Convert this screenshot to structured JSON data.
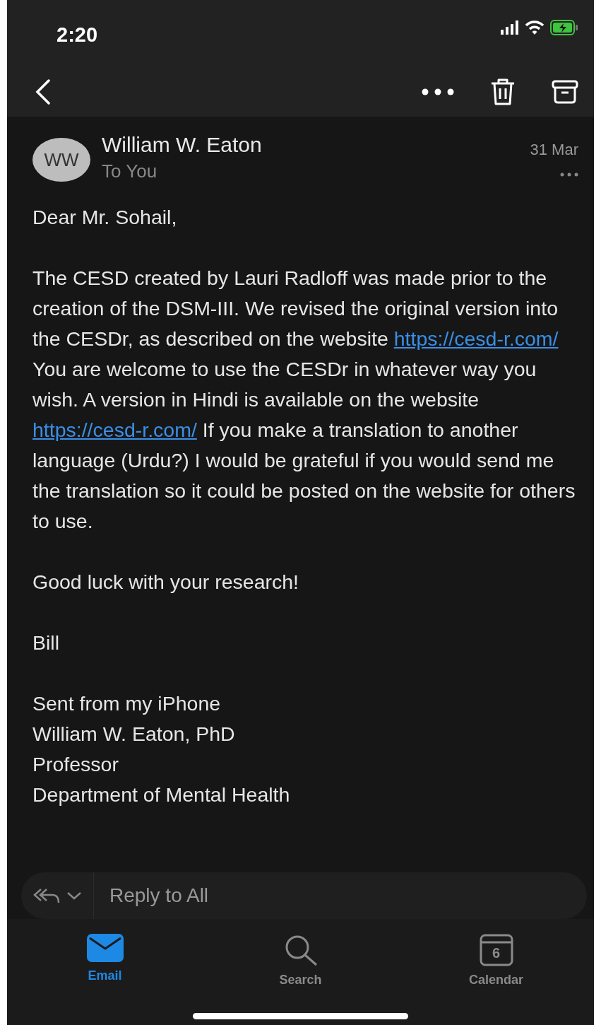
{
  "status_bar": {
    "time": "2:20"
  },
  "message": {
    "avatar_initials": "WW",
    "sender": "William W. Eaton",
    "recipient": "To You",
    "date": "31 Mar",
    "paragraphs": [
      {
        "parts": [
          {
            "kind": "text",
            "text": "Dear Mr. Sohail,"
          }
        ]
      },
      {
        "parts": [
          {
            "kind": "text",
            "text": "The CESD created by Lauri Radloff was made prior to the creation of the DSM-III.  We revised the original version into the CESDr, as described on the website "
          },
          {
            "kind": "link",
            "text": "https://cesd-r.com/"
          },
          {
            "kind": "text",
            "text": " You are welcome to use the CESDr in whatever way you wish.  A version in Hindi is available on the website "
          },
          {
            "kind": "link",
            "text": "https://cesd-r.com/"
          },
          {
            "kind": "text",
            "text": "   If you make a translation to another language (Urdu?) I would be grateful if you would send me the translation so it could be posted on the website for others to use."
          }
        ]
      },
      {
        "parts": [
          {
            "kind": "text",
            "text": "Good luck with your research!"
          }
        ]
      },
      {
        "parts": [
          {
            "kind": "text",
            "text": "Bill"
          }
        ]
      }
    ],
    "signature": [
      "Sent from my iPhone",
      "William W. Eaton, PhD",
      "Professor",
      "Department of Mental Health"
    ]
  },
  "reply_bar": {
    "placeholder": "Reply to All"
  },
  "tabs": [
    {
      "label": "Email",
      "kind": "email",
      "selected": true
    },
    {
      "label": "Search",
      "kind": "search",
      "selected": false
    },
    {
      "label": "Calendar",
      "kind": "calendar",
      "icon_text": "6",
      "selected": false
    }
  ]
}
